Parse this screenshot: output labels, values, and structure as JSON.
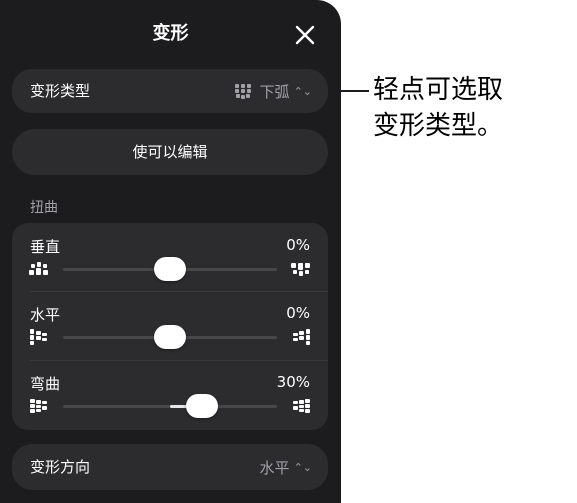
{
  "panel": {
    "title": "变形",
    "close_icon": "close-icon"
  },
  "warp_type": {
    "label": "变形类型",
    "icon": "arc-down-icon",
    "value": "下弧",
    "chevron": "⌃⌄"
  },
  "make_editable": {
    "label": "使可以编辑"
  },
  "distort": {
    "section_label": "扭曲",
    "sliders": [
      {
        "label": "垂直",
        "value_text": "0%",
        "value": 0,
        "min": -100,
        "max": 100,
        "left_icon": "vertical-distort-left-icon",
        "right_icon": "vertical-distort-right-icon"
      },
      {
        "label": "水平",
        "value_text": "0%",
        "value": 0,
        "min": -100,
        "max": 100,
        "left_icon": "horizontal-distort-left-icon",
        "right_icon": "horizontal-distort-right-icon"
      },
      {
        "label": "弯曲",
        "value_text": "30%",
        "value": 30,
        "min": -100,
        "max": 100,
        "left_icon": "bend-left-icon",
        "right_icon": "bend-right-icon"
      }
    ]
  },
  "warp_direction": {
    "label": "变形方向",
    "value": "水平",
    "chevron": "⌃⌄"
  },
  "callout": {
    "line1": "轻点可选取",
    "line2": "变形类型。"
  },
  "colors": {
    "panel_bg": "#1c1c1e",
    "row_bg": "#2c2c2e",
    "secondary_text": "#a1a1a6",
    "page_bg": "#ffffff"
  }
}
